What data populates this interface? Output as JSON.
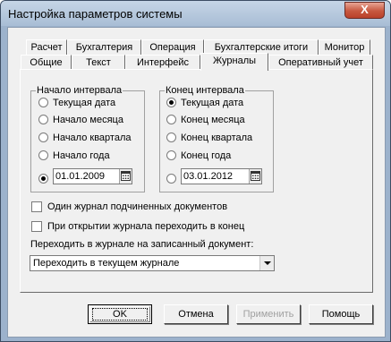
{
  "window": {
    "title": "Настройка параметров системы",
    "close_label": "X"
  },
  "tabs": {
    "row1": [
      "Расчет",
      "Бухгалтерия",
      "Операция",
      "Бухгалтерские итоги",
      "Монитор"
    ],
    "row2": [
      "Общие",
      "Текст",
      "Интерфейс",
      "Журналы",
      "Оперативный учет"
    ],
    "active": "Журналы"
  },
  "start_group": {
    "title": "Начало интервала",
    "options": [
      "Текущая дата",
      "Начало месяца",
      "Начало квартала",
      "Начало года"
    ],
    "selected": "custom",
    "date": "01.01.2009"
  },
  "end_group": {
    "title": "Конец интервала",
    "options": [
      "Текущая дата",
      "Конец месяца",
      "Конец квартала",
      "Конец года"
    ],
    "selected": "Текущая дата",
    "date": "03.01.2012"
  },
  "checkboxes": [
    {
      "label": "Один журнал подчиненных документов",
      "checked": false
    },
    {
      "label": "При открытии журнала переходить в конец",
      "checked": false
    }
  ],
  "goto_label": "Переходить в журнале на записанный документ:",
  "goto_select": {
    "value": "Переходить в текущем журнале"
  },
  "buttons": {
    "ok": "OK",
    "cancel": "Отмена",
    "apply": "Применить",
    "help": "Помощь"
  }
}
